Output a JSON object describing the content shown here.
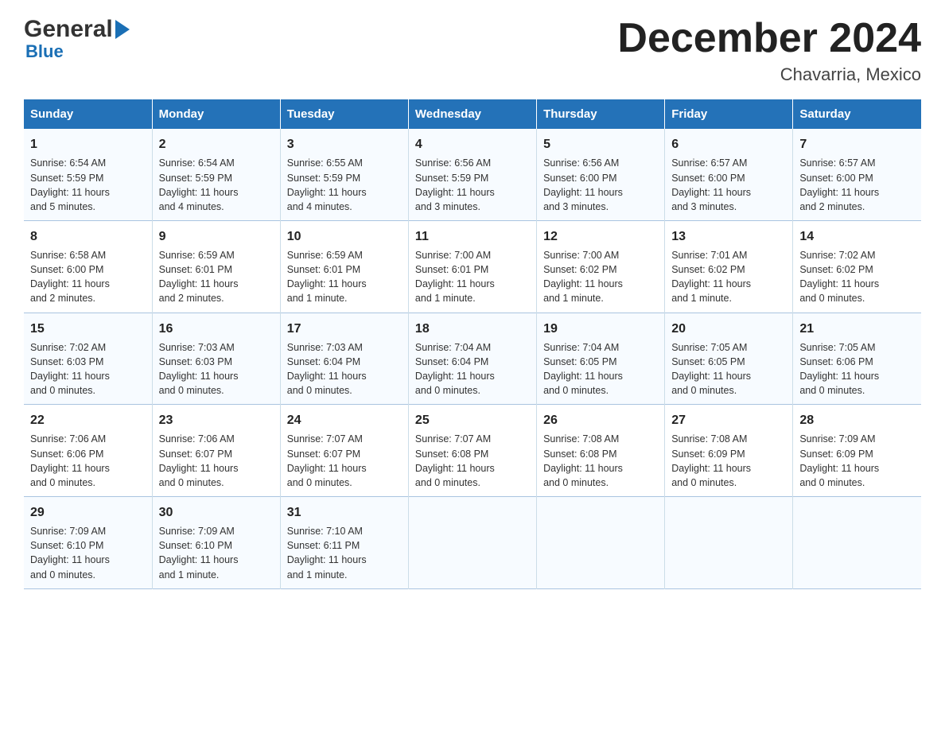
{
  "logo": {
    "general": "General",
    "blue": "Blue"
  },
  "title": "December 2024",
  "subtitle": "Chavarria, Mexico",
  "days_header": [
    "Sunday",
    "Monday",
    "Tuesday",
    "Wednesday",
    "Thursday",
    "Friday",
    "Saturday"
  ],
  "weeks": [
    [
      {
        "num": "1",
        "sunrise": "6:54 AM",
        "sunset": "5:59 PM",
        "daylight": "11 hours and 5 minutes."
      },
      {
        "num": "2",
        "sunrise": "6:54 AM",
        "sunset": "5:59 PM",
        "daylight": "11 hours and 4 minutes."
      },
      {
        "num": "3",
        "sunrise": "6:55 AM",
        "sunset": "5:59 PM",
        "daylight": "11 hours and 4 minutes."
      },
      {
        "num": "4",
        "sunrise": "6:56 AM",
        "sunset": "5:59 PM",
        "daylight": "11 hours and 3 minutes."
      },
      {
        "num": "5",
        "sunrise": "6:56 AM",
        "sunset": "6:00 PM",
        "daylight": "11 hours and 3 minutes."
      },
      {
        "num": "6",
        "sunrise": "6:57 AM",
        "sunset": "6:00 PM",
        "daylight": "11 hours and 3 minutes."
      },
      {
        "num": "7",
        "sunrise": "6:57 AM",
        "sunset": "6:00 PM",
        "daylight": "11 hours and 2 minutes."
      }
    ],
    [
      {
        "num": "8",
        "sunrise": "6:58 AM",
        "sunset": "6:00 PM",
        "daylight": "11 hours and 2 minutes."
      },
      {
        "num": "9",
        "sunrise": "6:59 AM",
        "sunset": "6:01 PM",
        "daylight": "11 hours and 2 minutes."
      },
      {
        "num": "10",
        "sunrise": "6:59 AM",
        "sunset": "6:01 PM",
        "daylight": "11 hours and 1 minute."
      },
      {
        "num": "11",
        "sunrise": "7:00 AM",
        "sunset": "6:01 PM",
        "daylight": "11 hours and 1 minute."
      },
      {
        "num": "12",
        "sunrise": "7:00 AM",
        "sunset": "6:02 PM",
        "daylight": "11 hours and 1 minute."
      },
      {
        "num": "13",
        "sunrise": "7:01 AM",
        "sunset": "6:02 PM",
        "daylight": "11 hours and 1 minute."
      },
      {
        "num": "14",
        "sunrise": "7:02 AM",
        "sunset": "6:02 PM",
        "daylight": "11 hours and 0 minutes."
      }
    ],
    [
      {
        "num": "15",
        "sunrise": "7:02 AM",
        "sunset": "6:03 PM",
        "daylight": "11 hours and 0 minutes."
      },
      {
        "num": "16",
        "sunrise": "7:03 AM",
        "sunset": "6:03 PM",
        "daylight": "11 hours and 0 minutes."
      },
      {
        "num": "17",
        "sunrise": "7:03 AM",
        "sunset": "6:04 PM",
        "daylight": "11 hours and 0 minutes."
      },
      {
        "num": "18",
        "sunrise": "7:04 AM",
        "sunset": "6:04 PM",
        "daylight": "11 hours and 0 minutes."
      },
      {
        "num": "19",
        "sunrise": "7:04 AM",
        "sunset": "6:05 PM",
        "daylight": "11 hours and 0 minutes."
      },
      {
        "num": "20",
        "sunrise": "7:05 AM",
        "sunset": "6:05 PM",
        "daylight": "11 hours and 0 minutes."
      },
      {
        "num": "21",
        "sunrise": "7:05 AM",
        "sunset": "6:06 PM",
        "daylight": "11 hours and 0 minutes."
      }
    ],
    [
      {
        "num": "22",
        "sunrise": "7:06 AM",
        "sunset": "6:06 PM",
        "daylight": "11 hours and 0 minutes."
      },
      {
        "num": "23",
        "sunrise": "7:06 AM",
        "sunset": "6:07 PM",
        "daylight": "11 hours and 0 minutes."
      },
      {
        "num": "24",
        "sunrise": "7:07 AM",
        "sunset": "6:07 PM",
        "daylight": "11 hours and 0 minutes."
      },
      {
        "num": "25",
        "sunrise": "7:07 AM",
        "sunset": "6:08 PM",
        "daylight": "11 hours and 0 minutes."
      },
      {
        "num": "26",
        "sunrise": "7:08 AM",
        "sunset": "6:08 PM",
        "daylight": "11 hours and 0 minutes."
      },
      {
        "num": "27",
        "sunrise": "7:08 AM",
        "sunset": "6:09 PM",
        "daylight": "11 hours and 0 minutes."
      },
      {
        "num": "28",
        "sunrise": "7:09 AM",
        "sunset": "6:09 PM",
        "daylight": "11 hours and 0 minutes."
      }
    ],
    [
      {
        "num": "29",
        "sunrise": "7:09 AM",
        "sunset": "6:10 PM",
        "daylight": "11 hours and 0 minutes."
      },
      {
        "num": "30",
        "sunrise": "7:09 AM",
        "sunset": "6:10 PM",
        "daylight": "11 hours and 1 minute."
      },
      {
        "num": "31",
        "sunrise": "7:10 AM",
        "sunset": "6:11 PM",
        "daylight": "11 hours and 1 minute."
      },
      null,
      null,
      null,
      null
    ]
  ],
  "labels": {
    "sunrise": "Sunrise:",
    "sunset": "Sunset:",
    "daylight": "Daylight:"
  },
  "accent_color": "#2472b8"
}
